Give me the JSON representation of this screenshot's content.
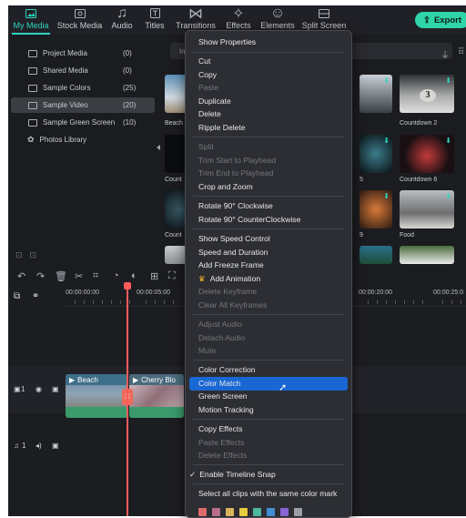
{
  "toolbar": {
    "tabs": [
      {
        "label": "My Media",
        "icon": "media-icon"
      },
      {
        "label": "Stock Media",
        "icon": "stock-icon"
      },
      {
        "label": "Audio",
        "icon": "audio-icon"
      },
      {
        "label": "Titles",
        "icon": "titles-icon"
      },
      {
        "label": "Transitions",
        "icon": "transitions-icon"
      },
      {
        "label": "Effects",
        "icon": "effects-icon"
      },
      {
        "label": "Elements",
        "icon": "elements-icon"
      },
      {
        "label": "Split Screen",
        "icon": "split-screen-icon"
      }
    ],
    "export_label": "Export",
    "accent_color": "#2fd4c0"
  },
  "sidebar": {
    "items": [
      {
        "label": "Project Media",
        "count": "(0)"
      },
      {
        "label": "Shared Media",
        "count": "(0)"
      },
      {
        "label": "Sample Colors",
        "count": "(25)"
      },
      {
        "label": "Sample Video",
        "count": "(20)"
      },
      {
        "label": "Sample Green Screen",
        "count": "(10)"
      },
      {
        "label": "Photos Library",
        "count": ""
      }
    ]
  },
  "media": {
    "search_placeholder": "Imp",
    "labels": [
      "Beach",
      "Countdown 2",
      "Count",
      "Countdown 6",
      "Count",
      "Food",
      "5",
      "9"
    ]
  },
  "timeline": {
    "timecodes": [
      "00:00:00:00",
      "00:00:05:00",
      "00:00:20:00",
      "00:00:25:0"
    ],
    "tracks": {
      "video": "1",
      "audio": "1"
    },
    "clips": [
      "Beach",
      "Cherry Blo"
    ]
  },
  "context_menu": {
    "items": {
      "show_properties": "Show Properties",
      "cut": "Cut",
      "copy": "Copy",
      "paste": "Paste",
      "duplicate": "Duplicate",
      "delete": "Delete",
      "ripple_delete": "Ripple Delete",
      "split": "Split",
      "trim_start": "Trim Start to Playhead",
      "trim_end": "Trim End to Playhead",
      "crop_zoom": "Crop and Zoom",
      "rotate_cw": "Rotate 90° Clockwise",
      "rotate_ccw": "Rotate 90° CounterClockwise",
      "speed_control": "Show Speed Control",
      "speed_duration": "Speed and Duration",
      "freeze_frame": "Add Freeze Frame",
      "add_animation": "Add Animation",
      "delete_keyframe": "Delete Keyframe",
      "clear_keyframes": "Clear All Keyframes",
      "adjust_audio": "Adjust Audio",
      "detach_audio": "Detach Audio",
      "mute": "Mute",
      "color_correction": "Color Correction",
      "color_match": "Color Match",
      "green_screen": "Green Screen",
      "motion_tracking": "Motion Tracking",
      "copy_effects": "Copy Effects",
      "paste_effects": "Paste Effects",
      "delete_effects": "Delete Effects",
      "timeline_snap": "Enable Timeline Snap",
      "select_same_color": "Select all clips with the same color mark"
    },
    "timeline_snap_checked": true,
    "highlight_color": "#1967d2",
    "color_marks": [
      "#e06b6b",
      "#e07a7a",
      "#d9b45a",
      "#e6cc3f",
      "#4fb7a1",
      "#3f8fd6",
      "#8a63d2",
      "#9aa0a6"
    ]
  }
}
